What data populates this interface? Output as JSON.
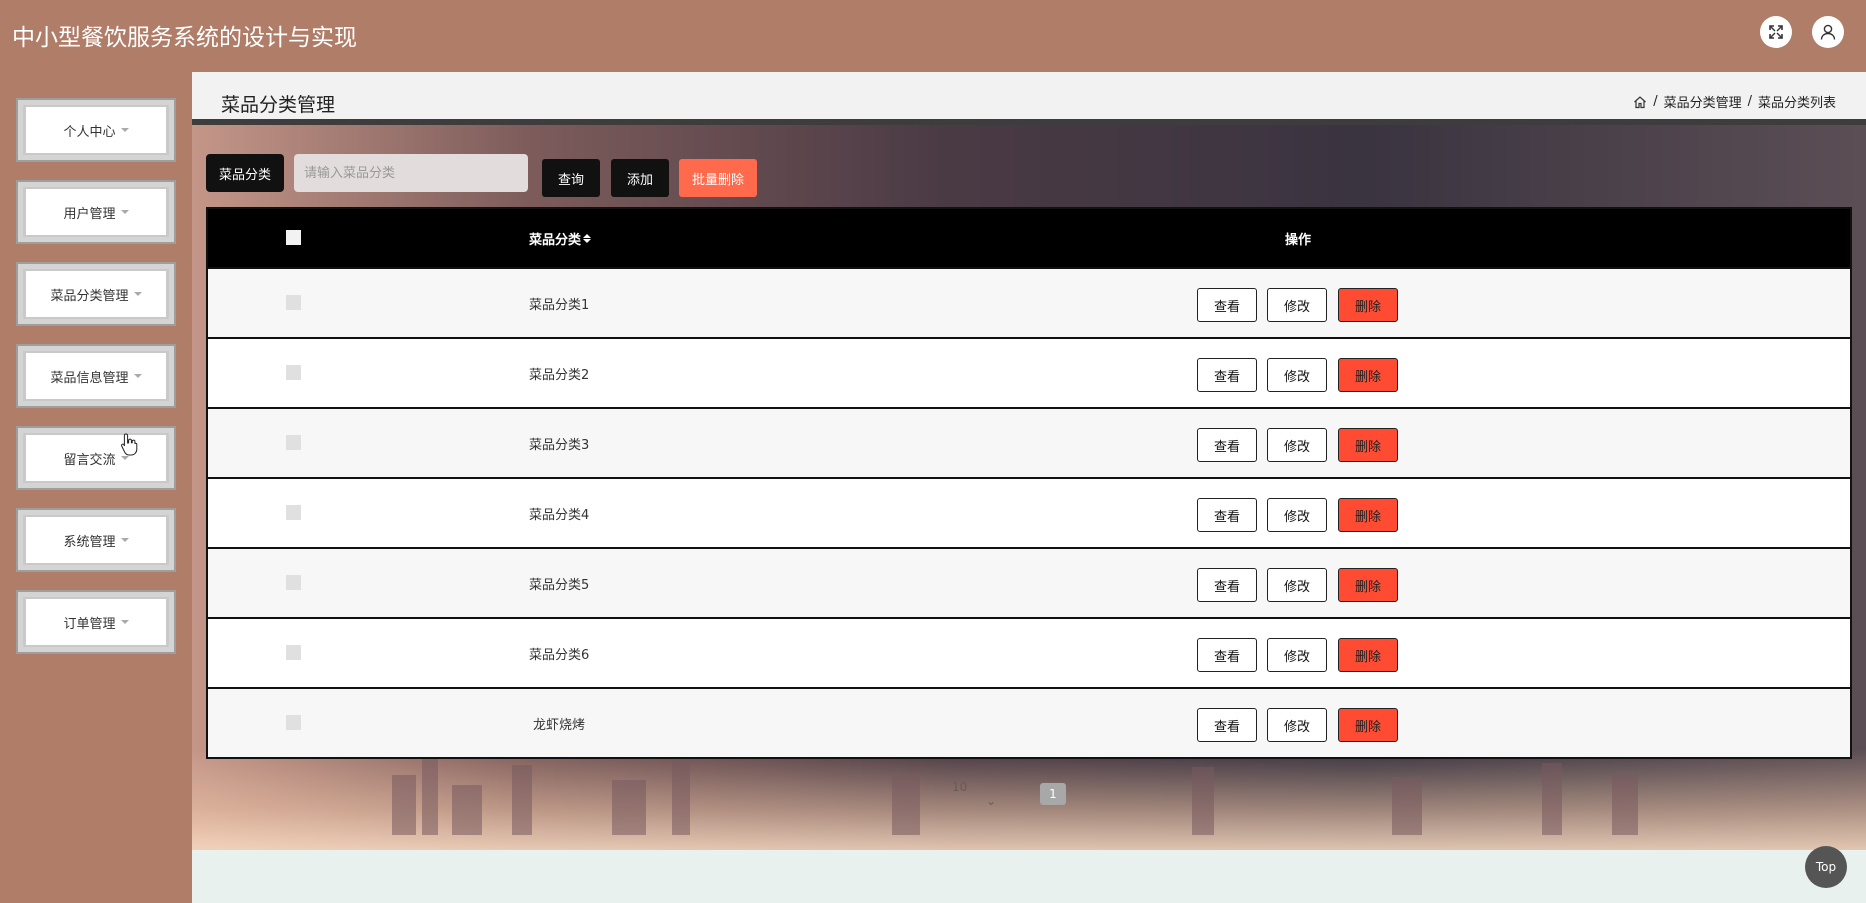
{
  "app": {
    "title": "中小型餐饮服务系统的设计与实现"
  },
  "header": {
    "fullscreen_icon": "fullscreen-icon",
    "user_icon": "user-icon"
  },
  "sidebar": {
    "items": [
      {
        "label": "个人中心"
      },
      {
        "label": "用户管理"
      },
      {
        "label": "菜品分类管理"
      },
      {
        "label": "菜品信息管理"
      },
      {
        "label": "留言交流"
      },
      {
        "label": "系统管理"
      },
      {
        "label": "订单管理"
      }
    ]
  },
  "page": {
    "title": "菜品分类管理",
    "breadcrumb": [
      "菜品分类管理",
      "菜品分类列表"
    ],
    "breadcrumb_sep": "/"
  },
  "search": {
    "label": "菜品分类",
    "placeholder": "请输入菜品分类",
    "value": ""
  },
  "toolbar": {
    "query_label": "查询",
    "add_label": "添加",
    "batch_delete_label": "批量删除"
  },
  "table": {
    "headers": {
      "name": "菜品分类",
      "actions": "操作"
    },
    "rows": [
      {
        "name": "菜品分类1"
      },
      {
        "name": "菜品分类2"
      },
      {
        "name": "菜品分类3"
      },
      {
        "name": "菜品分类4"
      },
      {
        "name": "菜品分类5"
      },
      {
        "name": "菜品分类6"
      },
      {
        "name": "龙虾烧烤"
      }
    ],
    "actions": {
      "view": "查看",
      "edit": "修改",
      "delete": "删除"
    }
  },
  "pagination": {
    "page_size": "10",
    "current_page": "1"
  },
  "top_button": "Top",
  "colors": {
    "header_bg": "#b07d68",
    "primary_dark": "#111111",
    "danger": "#ff4b32",
    "batch_delete": "#ff6a4c"
  }
}
